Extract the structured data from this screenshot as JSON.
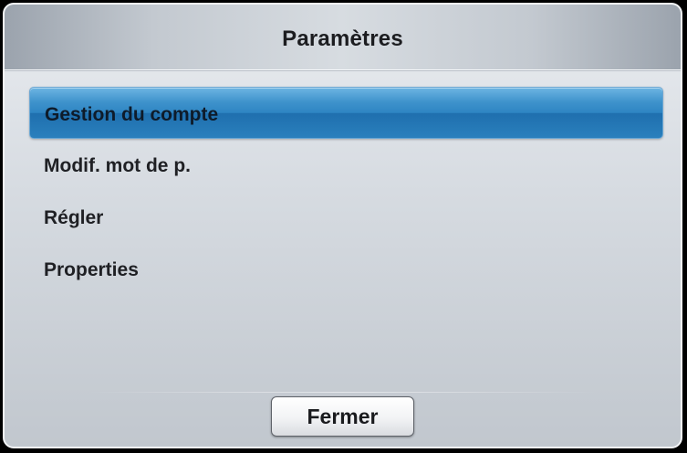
{
  "dialog": {
    "title": "Paramètres",
    "menu_items": [
      {
        "label": "Gestion du compte",
        "selected": true
      },
      {
        "label": "Modif. mot de p.",
        "selected": false
      },
      {
        "label": "Régler",
        "selected": false
      },
      {
        "label": "Properties",
        "selected": false
      }
    ],
    "close_label": "Fermer"
  },
  "colors": {
    "selection_blue": "#2e85c3",
    "background_top": "#e9ecf0",
    "background_bottom": "#c1c7ce",
    "text": "#1f2024"
  }
}
